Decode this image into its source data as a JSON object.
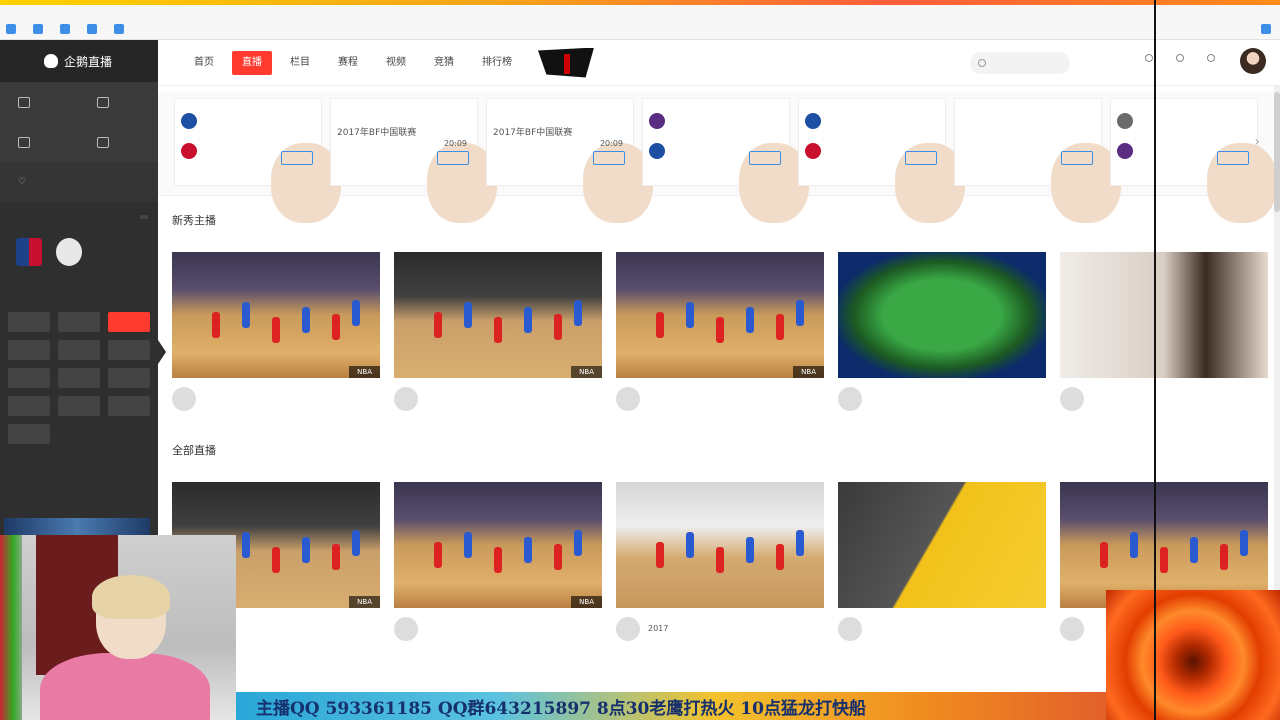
{
  "browser": {
    "bookmarks": [
      "",
      "",
      "",
      "",
      ""
    ],
    "right_link": ""
  },
  "sidebar": {
    "brand": "企鹅直播",
    "menu": [
      "",
      "",
      "",
      ""
    ],
    "follow": "",
    "follow_hint": "",
    "teams_title": "",
    "teams_tag": "",
    "teams": [
      "",
      ""
    ],
    "cats_title": "",
    "categories": [
      {
        "label": "",
        "active": false
      },
      {
        "label": "",
        "active": false
      },
      {
        "label": "",
        "active": true
      },
      {
        "label": "",
        "active": false
      },
      {
        "label": "",
        "active": false
      },
      {
        "label": "",
        "active": false
      },
      {
        "label": "",
        "active": false
      },
      {
        "label": "",
        "active": false
      },
      {
        "label": "",
        "active": false
      },
      {
        "label": "",
        "active": false
      },
      {
        "label": "",
        "active": false
      },
      {
        "label": "",
        "active": false
      },
      {
        "label": "",
        "active": false
      }
    ]
  },
  "nav": {
    "tabs": [
      {
        "label": "首页",
        "active": false,
        "hot": false
      },
      {
        "label": "直播",
        "active": true,
        "hot": false
      },
      {
        "label": "栏目",
        "active": false,
        "hot": false
      },
      {
        "label": "赛程",
        "active": false,
        "hot": false
      },
      {
        "label": "视频",
        "active": false,
        "hot": false
      },
      {
        "label": "竞猜",
        "active": false,
        "hot": true
      },
      {
        "label": "排行榜",
        "active": false,
        "hot": true
      }
    ],
    "search_placeholder": "",
    "actions": [
      "",
      "",
      ""
    ]
  },
  "schedule": {
    "cards": [
      {
        "head": "",
        "status": "",
        "teams": [
          {
            "name": "",
            "score": ""
          },
          {
            "name": "",
            "score": ""
          }
        ],
        "title": "",
        "sub": "",
        "time": "",
        "btn": ""
      },
      {
        "head": "",
        "status": "",
        "teams": [],
        "title": "2017年BF中国联赛",
        "sub": "",
        "time": "20:09",
        "btn": ""
      },
      {
        "head": "",
        "status": "",
        "teams": [],
        "title": "2017年BF中国联赛",
        "sub": "",
        "time": "20:09",
        "btn": ""
      },
      {
        "head": "",
        "status": "",
        "teams": [
          {
            "name": "",
            "score": ""
          },
          {
            "name": "",
            "score": ""
          }
        ],
        "title": "",
        "sub": "",
        "time": "",
        "btn": ""
      },
      {
        "head": "",
        "status": "",
        "teams": [
          {
            "name": "",
            "score": ""
          },
          {
            "name": "",
            "score": ""
          }
        ],
        "title": "",
        "sub": "",
        "time": "",
        "btn": ""
      },
      {
        "head": "",
        "status": "",
        "teams": [],
        "title": "",
        "sub": "",
        "time": "",
        "btn": ""
      },
      {
        "head": "",
        "status": "",
        "teams": [
          {
            "name": "",
            "score": ""
          },
          {
            "name": "",
            "score": ""
          }
        ],
        "title": "",
        "sub": "",
        "time": "",
        "btn": ""
      }
    ]
  },
  "sections": {
    "new_title": "新秀主播",
    "all_title": "全部直播"
  },
  "row1": [
    {
      "scene": "court",
      "badge": "NBA",
      "live": "",
      "title": "",
      "sub": "",
      "count": ""
    },
    {
      "scene": "court2",
      "badge": "NBA",
      "live": "",
      "title": "",
      "sub": "",
      "count": ""
    },
    {
      "scene": "court",
      "badge": "NBA",
      "live": "",
      "title": "",
      "sub": "",
      "count": ""
    },
    {
      "scene": "snooker",
      "badge": "",
      "live": "",
      "title": "",
      "sub": "",
      "count": ""
    },
    {
      "scene": "studio",
      "badge": "",
      "live": "",
      "title": "",
      "sub": "",
      "count": ""
    }
  ],
  "row2": [
    {
      "scene": "court2",
      "badge": "NBA",
      "live": "",
      "title": "",
      "sub": "",
      "count": ""
    },
    {
      "scene": "court",
      "badge": "NBA",
      "live": "",
      "title": "",
      "sub": "",
      "count": ""
    },
    {
      "scene": "court3",
      "badge": "",
      "live": "",
      "title": "2017",
      "sub": "",
      "count": ""
    },
    {
      "scene": "yellow",
      "badge": "",
      "live": "",
      "title": "",
      "sub": "",
      "count": ""
    },
    {
      "scene": "court",
      "badge": "",
      "live": "",
      "title": "",
      "sub": "",
      "count": ""
    }
  ],
  "marquee": "主播QQ 593361185  QQ群643215897 8点30老鹰打热火 10点猛龙打快船"
}
